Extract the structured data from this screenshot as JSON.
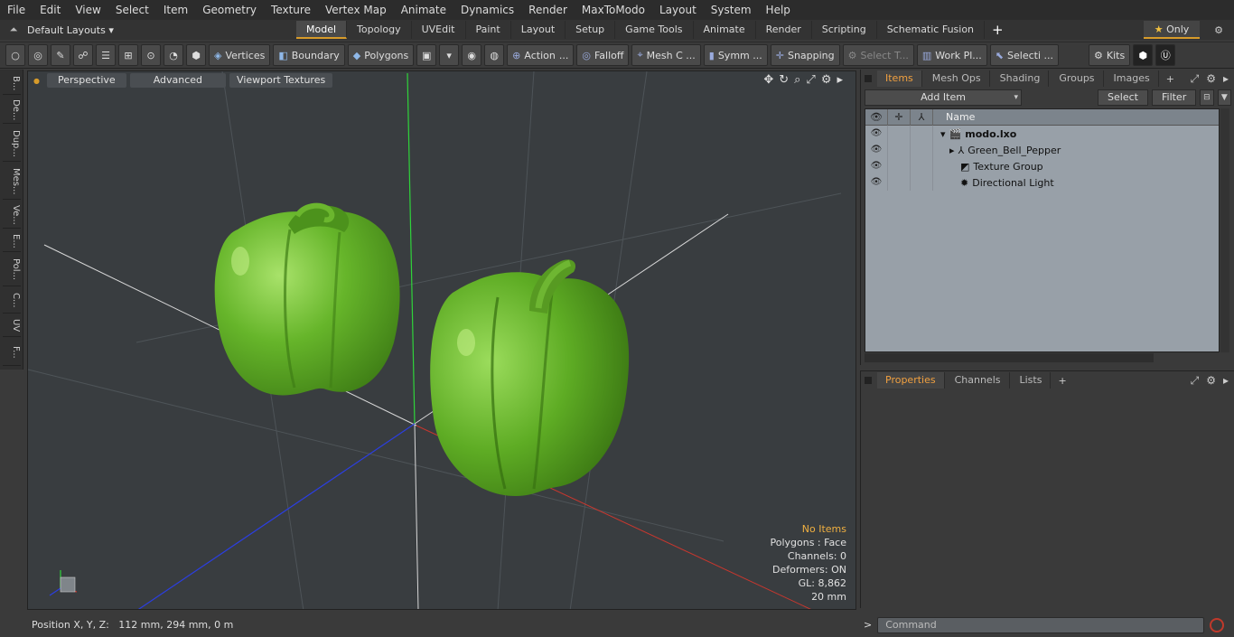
{
  "menu": [
    "File",
    "Edit",
    "View",
    "Select",
    "Item",
    "Geometry",
    "Texture",
    "Vertex Map",
    "Animate",
    "Dynamics",
    "Render",
    "MaxToModo",
    "Layout",
    "System",
    "Help"
  ],
  "layouts_label": "Default Layouts",
  "mode_tabs": [
    {
      "label": "Model",
      "active": true
    },
    {
      "label": "Topology",
      "active": false
    },
    {
      "label": "UVEdit",
      "active": false
    },
    {
      "label": "Paint",
      "active": false
    },
    {
      "label": "Layout",
      "active": false
    },
    {
      "label": "Setup",
      "active": false
    },
    {
      "label": "Game Tools",
      "active": false
    },
    {
      "label": "Animate",
      "active": false
    },
    {
      "label": "Render",
      "active": false
    },
    {
      "label": "Scripting",
      "active": false
    },
    {
      "label": "Schematic Fusion",
      "active": false
    }
  ],
  "only_label": "Only",
  "toolbar": {
    "vertices": "Vertices",
    "boundary": "Boundary",
    "polygons": "Polygons",
    "action": "Action",
    "falloff": "Falloff",
    "mesh": "Mesh C ...",
    "symmetry": "Symm ...",
    "snapping": "Snapping",
    "select_t": "Select T...",
    "work_plane": "Work Pl...",
    "selection": "Selecti ...",
    "kits": "Kits"
  },
  "left_tabs": [
    "B...",
    "De...",
    "Dup...",
    "Mes...",
    "Ve...",
    "E...",
    "Pol...",
    "C...",
    "UV",
    "F..."
  ],
  "viewport": {
    "perspective": "Perspective",
    "advanced": "Advanced",
    "textures": "Viewport Textures",
    "info": {
      "items": "No Items",
      "polygons": "Polygons : Face",
      "channels": "Channels: 0",
      "deformers": "Deformers: ON",
      "gl": "GL: 8,862",
      "scale": "20 mm"
    }
  },
  "position": "Position X, Y, Z:   112 mm, 294 mm, 0 m",
  "items_panel": {
    "tabs": [
      {
        "label": "Items",
        "active": true
      },
      {
        "label": "Mesh Ops",
        "active": false
      },
      {
        "label": "Shading",
        "active": false
      },
      {
        "label": "Groups",
        "active": false
      },
      {
        "label": "Images",
        "active": false
      }
    ],
    "add_item": "Add Item",
    "select": "Select",
    "filter": "Filter",
    "name_header": "Name",
    "tree": [
      {
        "label": "modo.lxo",
        "bold": true
      },
      {
        "label": "Green_Bell_Pepper",
        "bold": false
      },
      {
        "label": "Texture Group",
        "bold": false
      },
      {
        "label": "Directional Light",
        "bold": false
      }
    ]
  },
  "properties_panel": {
    "tabs": [
      {
        "label": "Properties",
        "active": true
      },
      {
        "label": "Channels",
        "active": false
      },
      {
        "label": "Lists",
        "active": false
      }
    ]
  },
  "command_placeholder": "Command"
}
